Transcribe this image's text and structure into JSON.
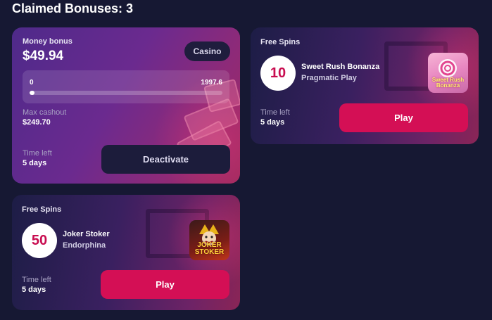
{
  "heading": "Claimed Bonuses: 3",
  "colors": {
    "accent_pink": "#d40f55",
    "dark_button": "#1c1c3b",
    "background": "#161833"
  },
  "money_bonus": {
    "label": "Money bonus",
    "amount": "$49.94",
    "category_chip": "Casino",
    "progress": {
      "min_label": "0",
      "max_label": "1997.6",
      "current": 49.94,
      "max": 1997.6
    },
    "max_cashout_label": "Max cashout",
    "max_cashout_value": "$249.70",
    "time_left_label": "Time left",
    "time_left_value": "5 days",
    "action_label": "Deactivate"
  },
  "free_spins": [
    {
      "label": "Free Spins",
      "spins": "10",
      "game_title": "Sweet Rush Bonanza",
      "provider": "Pragmatic Play",
      "thumb_caption": "Sweet Rush Bonanza",
      "time_left_label": "Time left",
      "time_left_value": "5 days",
      "action_label": "Play"
    },
    {
      "label": "Free Spins",
      "spins": "50",
      "game_title": "Joker Stoker",
      "provider": "Endorphina",
      "thumb_caption": "JOKER STOKER",
      "time_left_label": "Time left",
      "time_left_value": "5 days",
      "action_label": "Play"
    }
  ]
}
